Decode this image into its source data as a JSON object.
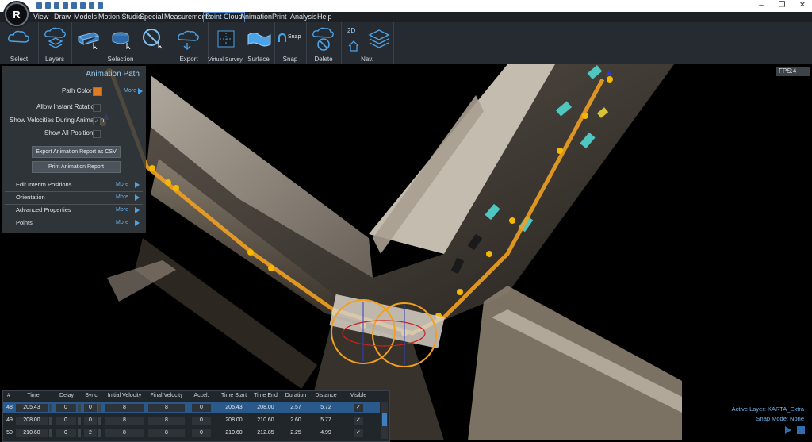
{
  "app": {
    "logo_letter": "R",
    "menu": [
      "View",
      "Draw",
      "Models",
      "Motion Studio",
      "Special",
      "Measurements",
      "Point Cloud",
      "Animation",
      "Print",
      "Analysis",
      "Help"
    ],
    "active_menu": "Point Cloud",
    "window_buttons": [
      "–",
      "❐",
      "✕"
    ]
  },
  "ribbon": {
    "groups": [
      "Select",
      "Layers",
      "Selection",
      "Export",
      "Virtual Survey",
      "Surface",
      "Snap",
      "Delete",
      "Nav."
    ],
    "snap_button": "Snap",
    "nav_mode": "2D"
  },
  "panel": {
    "title": "Animation Path",
    "path_color_label": "Path Color",
    "path_color": "#e07b22",
    "more": "More",
    "allow_instant_rotation": "Allow Instant Rotation",
    "show_velocities": "Show Velocities During Animation",
    "show_velocities_checked": true,
    "show_all_positions": "Show All Positions",
    "export_button": "Export Animation Report as CSV",
    "print_button": "Print Animation Report",
    "sections": [
      "Edit Interim Positions",
      "Orientation",
      "Advanced Properties",
      "Points"
    ]
  },
  "viewport": {
    "fps": "FPS:4",
    "active_layer": "Active Layer: KARTA_Extra",
    "snap_mode": "Snap Mode: None"
  },
  "table": {
    "columns": [
      "#",
      "Time",
      "Delay",
      "Sync",
      "Initial Velocity",
      "Final Velocity",
      "Accel.",
      "Time Start",
      "Time End",
      "Duration",
      "Distance",
      "Visible"
    ],
    "rows": [
      [
        "48",
        "205.43",
        "0",
        "0",
        "8",
        "8",
        "0",
        "205.43",
        "208.00",
        "2.57",
        "5.72",
        "✓"
      ],
      [
        "49",
        "208.00",
        "0",
        "0",
        "8",
        "8",
        "0",
        "208.00",
        "210.60",
        "2.60",
        "5.77",
        "✓"
      ],
      [
        "50",
        "210.60",
        "0",
        "2",
        "8",
        "8",
        "0",
        "210.60",
        "212.85",
        "2.25",
        "4.99",
        "✓"
      ]
    ]
  },
  "colors": {
    "path": "#f0a020",
    "marker": "#f5b800",
    "car": "#4fc6c0",
    "accent": "#4ba3e8"
  }
}
